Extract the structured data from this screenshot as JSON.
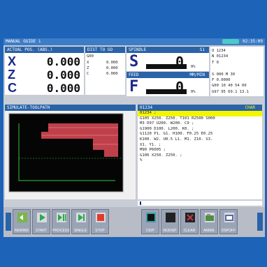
{
  "titlebar": {
    "mode": "MANUAL GUIDE i",
    "time": "02:35:09"
  },
  "position": {
    "header": "ACTUAL POS. (ABS.)",
    "axes": [
      {
        "name": "X",
        "value": "0.000"
      },
      {
        "name": "Z",
        "value": "0.000"
      },
      {
        "name": "C",
        "value": "0.000"
      }
    ]
  },
  "dist_to_go": {
    "header": "DIST TO GO",
    "label": "G00",
    "rows": [
      {
        "name": "X",
        "value": "0.000"
      },
      {
        "name": "Z",
        "value": "0.000"
      },
      {
        "name": "C",
        "value": "0.000"
      }
    ]
  },
  "spindle": {
    "header": "SPINDLE",
    "id": "S1",
    "letter": "S",
    "value": "0",
    "load": "0%",
    "load_fraction": 0.0
  },
  "feed": {
    "header": "FEED",
    "unit": "MM/MIN",
    "letter": "F",
    "value": "0",
    "override": "0%",
    "load_fraction": 0.0
  },
  "info": {
    "lines": [
      "O 1234",
      "N 01234",
      "T 0",
      "",
      "S      000  M 30",
      "F        0.0000",
      "G00 10 40 54 00",
      "G97 95 69.1  13.1"
    ]
  },
  "simulate": {
    "header": "SIMULATE-TOOLPATH"
  },
  "program": {
    "number": "01234",
    "mode": "CHAR",
    "lines": [
      "01234 ;",
      "G105 X250. Z250. T101 R2500 S000",
      "M3 D97 U200. W200. C9 ;",
      "G1900 D100. L200. K0. ;",
      "G1120 P1. G1. H100. F0.25 E0.25",
      "K100. W2. U0.5 L1. M1. Z10. S3.",
      "X1. Y1. ;",
      "M90 P6005 ;",
      "G106 X250. Z250. ;",
      "%"
    ],
    "current_line": 0
  },
  "softkeys": [
    {
      "label": "REWIND",
      "icon": "rewind-icon",
      "color": "#7ab648"
    },
    {
      "label": "START",
      "icon": "play-icon",
      "color": "#2ea84b"
    },
    {
      "label": "PROCESS",
      "icon": "pause-play-icon",
      "color": "#2ea84b"
    },
    {
      "label": "SINGLE",
      "icon": "step-icon",
      "color": "#2ea84b"
    },
    {
      "label": "STOP",
      "icon": "stop-icon",
      "color": "#e23a2a"
    },
    {
      "label": "DISP",
      "icon": "display-icon",
      "color": "#3aa0a8"
    },
    {
      "label": "NODISP",
      "icon": "no-display-icon",
      "color": "#222222"
    },
    {
      "label": "CLEAR",
      "icon": "clear-icon",
      "color": "#c23a44"
    },
    {
      "label": "ANIME",
      "icon": "animation-icon",
      "color": "#4f8f3d"
    },
    {
      "label": "DSPOFF",
      "icon": "display-off-icon",
      "color": "#5a6c9e"
    }
  ]
}
